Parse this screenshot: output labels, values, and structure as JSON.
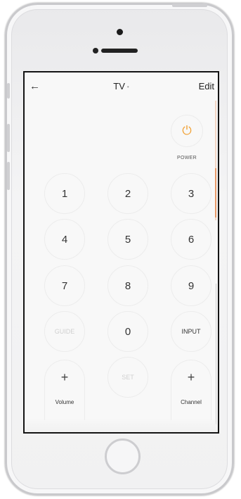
{
  "header": {
    "back_icon": "←",
    "title": "TV",
    "title_indicator": "•",
    "edit_label": "Edit"
  },
  "power": {
    "icon": "power-icon",
    "glyph": "⏻",
    "label": "POWER",
    "color": "#f1a032"
  },
  "keypad": {
    "k1": "1",
    "k2": "2",
    "k3": "3",
    "k4": "4",
    "k5": "5",
    "k6": "6",
    "k7": "7",
    "k8": "8",
    "k9": "9",
    "guide": "GUIDE",
    "k0": "0",
    "input": "INPUT"
  },
  "volume": {
    "plus": "+",
    "label": "Volume"
  },
  "set_label": "SET",
  "channel": {
    "plus": "+",
    "label": "Channel"
  },
  "accent_color": "#e89a68"
}
